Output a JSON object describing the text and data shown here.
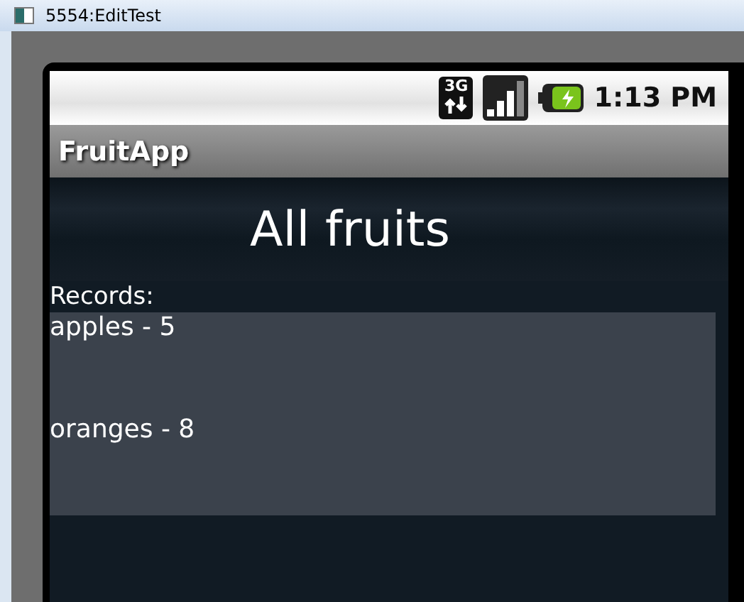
{
  "window": {
    "title": "5554:EditTest"
  },
  "status_bar": {
    "time": "1:13 PM",
    "network": "3G"
  },
  "app_bar": {
    "title": "FruitApp"
  },
  "heading": "All fruits",
  "records_label": "Records:",
  "records": [
    {
      "text": "apples - 5"
    },
    {
      "text": "oranges - 8"
    }
  ]
}
